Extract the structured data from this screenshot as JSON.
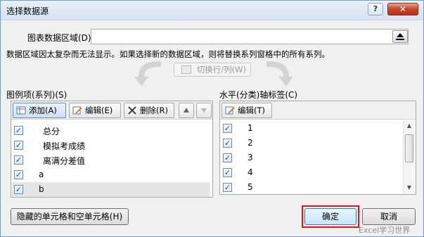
{
  "window": {
    "title": "选择数据源",
    "help_label": "?",
    "close_label": "✕"
  },
  "range": {
    "label": "图表数据区域(D):",
    "value": ""
  },
  "warning_text": "数据区域因太复杂而无法显示。如果选择新的数据区域，则将替换系列窗格中的所有系列。",
  "switch_button": {
    "label": "切换行/列(W)",
    "icon": "switch-row-column-icon"
  },
  "legend": {
    "label": "图例项(系列)(S)",
    "toolbar": {
      "add_label": "添加(A)",
      "edit_label": "编辑(E)",
      "remove_label": "删除(R)",
      "up_icon": "triangle-up-icon",
      "down_icon": "triangle-down-icon"
    },
    "items": [
      {
        "label": "总分",
        "checked": true
      },
      {
        "label": "模拟考成绩",
        "checked": true
      },
      {
        "label": "离满分差值",
        "checked": true
      },
      {
        "label": "a",
        "checked": true
      },
      {
        "label": "b",
        "checked": true
      }
    ]
  },
  "axis": {
    "label": "水平(分类)轴标签(C)",
    "toolbar": {
      "edit_label": "编辑(T)"
    },
    "items": [
      {
        "label": "1",
        "checked": true
      },
      {
        "label": "2",
        "checked": true
      },
      {
        "label": "3",
        "checked": true
      },
      {
        "label": "4",
        "checked": true
      },
      {
        "label": "5",
        "checked": true
      }
    ]
  },
  "footer": {
    "hidden_cells_label": "隐藏的单元格和空单元格(H)",
    "ok_label": "确定",
    "cancel_label": "取消"
  },
  "watermark": "Excel学习世界",
  "colors": {
    "highlight": "#e0141e",
    "close": "#c7432a",
    "selection": "#e6e6e6"
  }
}
